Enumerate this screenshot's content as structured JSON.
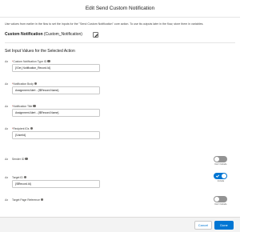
{
  "header": {
    "title": "Edit Send Custom Notification"
  },
  "description": "Use values from earlier in the flow to set the inputs for the \"Send Custom Notification\" core action. To use its outputs later in the flow, store them in variables.",
  "action": {
    "name_bold": "Custom Notification",
    "name_rest": " (Custom_Notification)"
  },
  "section_title": "Set Input Values for the Selected Action",
  "fields": [
    {
      "prefix": "Aa",
      "required": "*",
      "label": "Custom Notification Type ID",
      "value": "{!Get_Notification_Record.Id}"
    },
    {
      "prefix": "Aa",
      "required": "*",
      "label": "Notification Body",
      "value": "Assignment Alert - {!$Record.Name}"
    },
    {
      "prefix": "Aa",
      "required": "*",
      "label": "Notification Title",
      "value": "Assignment Alert - {!$Record.Name}"
    },
    {
      "prefix": "Aa",
      "required": "*",
      "label": "Recipient IDs",
      "value": "{!UserId}"
    },
    {
      "prefix": "Aa",
      "required": "",
      "label": "Sender ID",
      "toggle": "Don't Include"
    },
    {
      "prefix": "Aa",
      "required": "",
      "label": "Target ID",
      "value": "{!$Record.Id}",
      "toggle": "Include"
    },
    {
      "prefix": "Aa",
      "required": "",
      "label": "Target Page Reference",
      "toggle": "Don't Include"
    }
  ],
  "footer": {
    "cancel_label": "Cancel",
    "done_label": "Done"
  },
  "colors": {
    "brand": "#0176d3",
    "toggle_off": "#939393"
  }
}
